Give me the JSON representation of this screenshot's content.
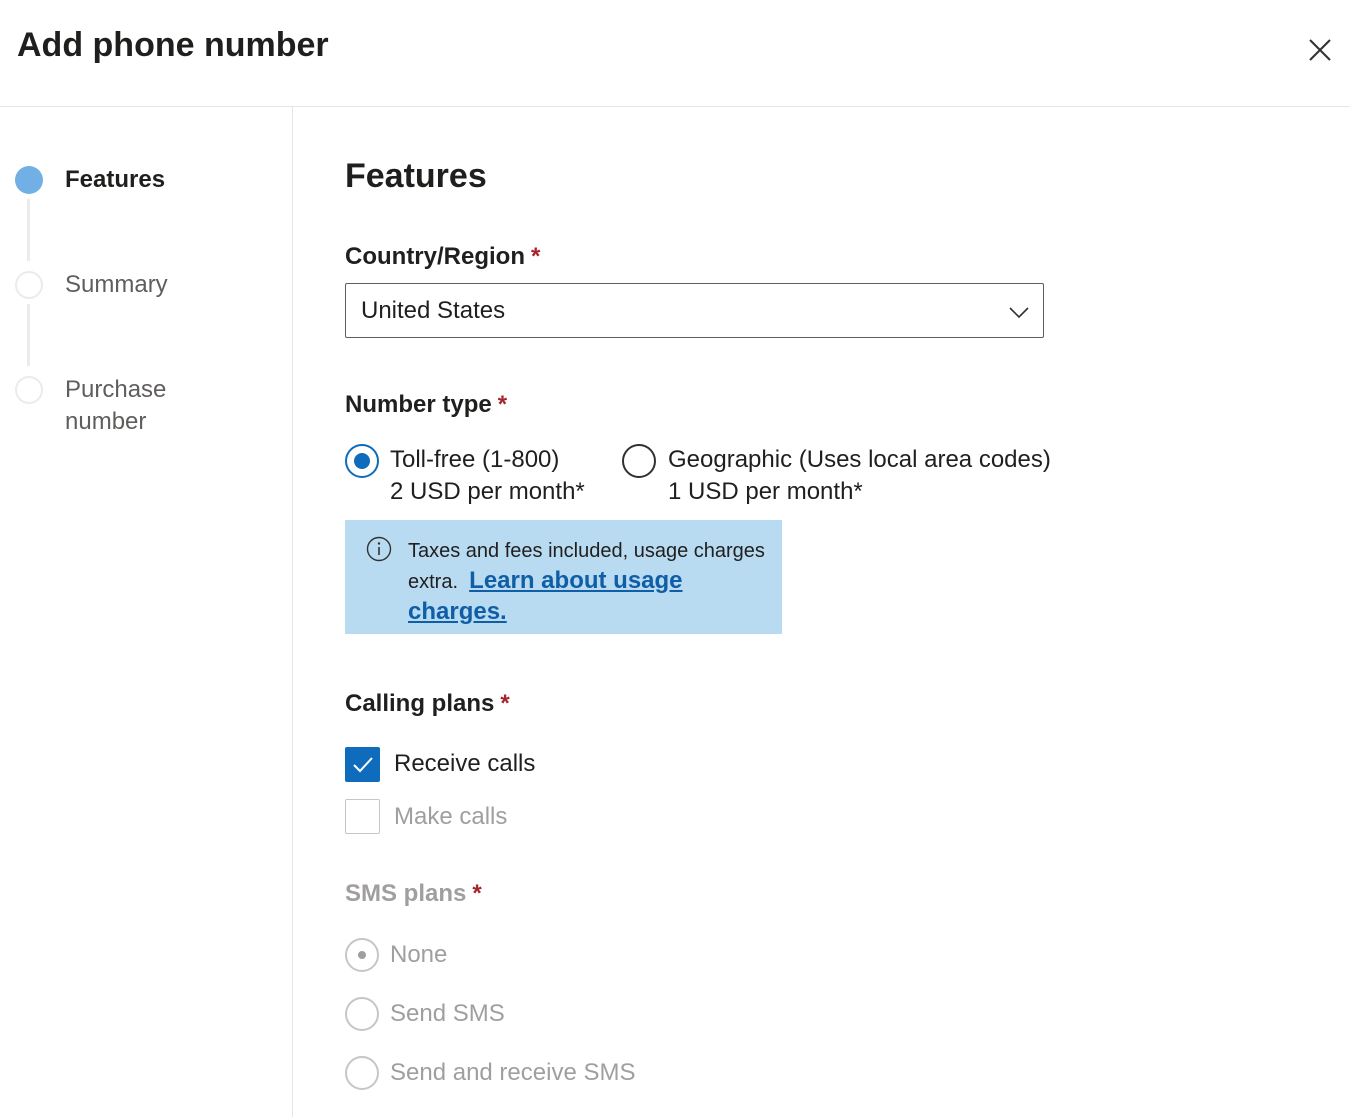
{
  "dialog": {
    "title": "Add phone number",
    "close_icon": "close-icon"
  },
  "steps": [
    {
      "label": "Features",
      "state": "active"
    },
    {
      "label": "Summary",
      "state": "pending"
    },
    {
      "label": "Purchase number",
      "state": "pending"
    }
  ],
  "main": {
    "section_title": "Features",
    "required_marker": "*",
    "country": {
      "label": "Country/Region",
      "value": "United States",
      "chevron_icon": "chevron-down-icon"
    },
    "number_type": {
      "label": "Number type",
      "options": [
        {
          "line1": "Toll-free (1-800)",
          "line2": "2 USD per month*",
          "selected": true
        },
        {
          "line1": "Geographic (Uses local area codes)",
          "line2": "1 USD per month*",
          "selected": false
        }
      ]
    },
    "info": {
      "icon": "info-icon",
      "text": "Taxes and fees included, usage charges extra.",
      "link": "Learn about usage charges.",
      "background": "#b8dbf2"
    },
    "calling_plans": {
      "label": "Calling plans",
      "options": [
        {
          "label": "Receive calls",
          "checked": true
        },
        {
          "label": "Make calls",
          "checked": false,
          "disabled": true
        }
      ]
    },
    "sms_plans": {
      "label": "SMS plans",
      "disabled": true,
      "options": [
        {
          "label": "None",
          "selected": true
        },
        {
          "label": "Send SMS",
          "selected": false
        },
        {
          "label": "Send and receive SMS",
          "selected": false
        }
      ]
    }
  },
  "colors": {
    "accent": "#0f6cbd",
    "step_active": "#71afe5",
    "required": "#a4262c",
    "disabled_text": "#a19f9d"
  }
}
